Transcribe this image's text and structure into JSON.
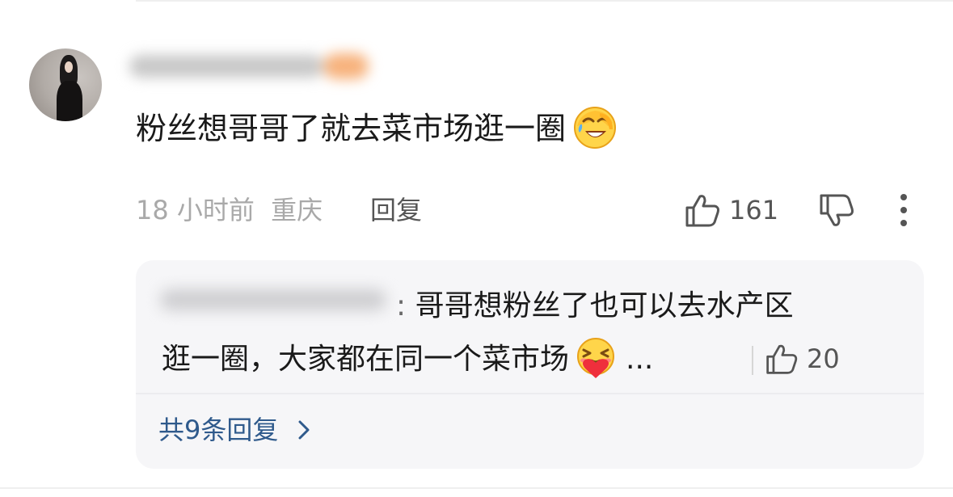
{
  "comment": {
    "text": "粉丝想哥哥了就去菜市场逛一圈",
    "emoji": "laughing-emoji",
    "time": "18 小时前",
    "location": "重庆",
    "reply_label": "回复",
    "like_count": "161"
  },
  "reply_preview": {
    "text_line1": "哥哥想粉丝了也可以去水产区",
    "text_line2": "逛一圈，大家都在同一个菜市场",
    "emoji": "hugging-heart-emoji",
    "ellipsis": "...",
    "like_count": "20",
    "more_replies_label": "共9条回复"
  },
  "colors": {
    "text_primary": "#1a1a1a",
    "text_meta": "#a9a9a9",
    "text_secondary": "#555555",
    "link_blue": "#2f5a8c",
    "reply_bg": "#f6f6f8"
  }
}
